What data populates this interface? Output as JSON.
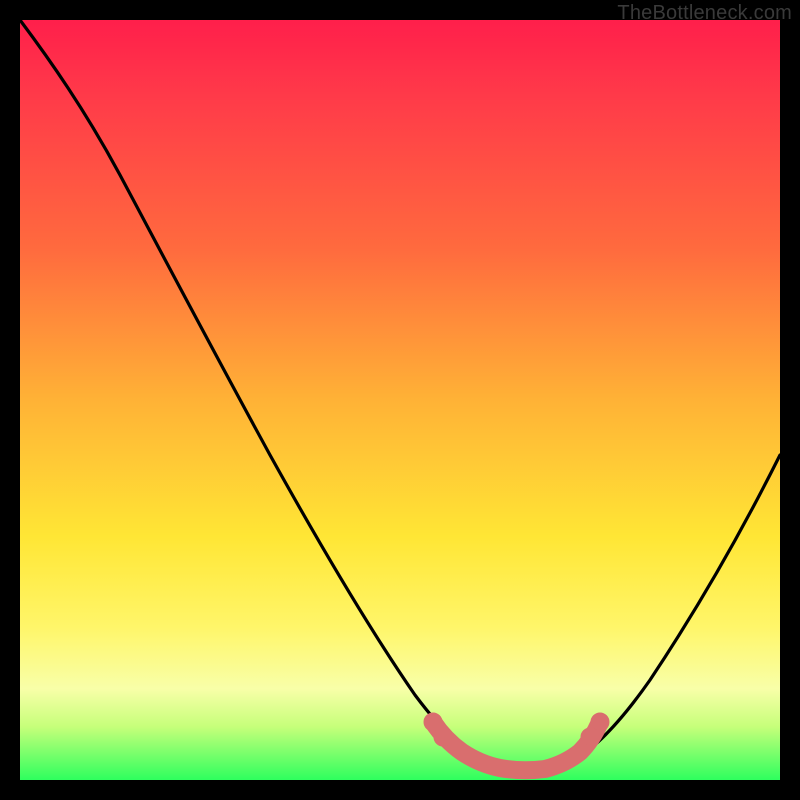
{
  "watermark": "TheBottleneck.com",
  "chart_data": {
    "type": "line",
    "title": "",
    "xlabel": "",
    "ylabel": "",
    "xlim": [
      0,
      100
    ],
    "ylim": [
      0,
      100
    ],
    "grid": false,
    "series": [
      {
        "name": "bottleneck-curve",
        "x": [
          0,
          6,
          12,
          18,
          24,
          30,
          36,
          42,
          48,
          52,
          56,
          60,
          64,
          68,
          72,
          76,
          80,
          84,
          88,
          92,
          96,
          100
        ],
        "y": [
          100,
          94,
          84,
          73,
          62,
          51,
          40,
          29,
          18,
          11,
          5,
          2,
          0,
          0,
          1,
          3,
          8,
          15,
          23,
          32,
          41,
          50
        ]
      }
    ],
    "annotations": [
      {
        "name": "optimal-highlight",
        "type": "segment",
        "color": "#d66a6a",
        "points_x": [
          54,
          55,
          58,
          60,
          63,
          66,
          69,
          71,
          73,
          75
        ],
        "points_y": [
          6.5,
          5.5,
          3.2,
          2.2,
          1.4,
          1.4,
          2.2,
          3.4,
          5.2,
          7.5
        ]
      }
    ],
    "background": {
      "type": "vertical-gradient",
      "stops": [
        {
          "pos": 0.0,
          "color": "#ff1f4b"
        },
        {
          "pos": 0.5,
          "color": "#ffb236"
        },
        {
          "pos": 0.8,
          "color": "#fff66a"
        },
        {
          "pos": 0.93,
          "color": "#c6ff7a"
        },
        {
          "pos": 1.0,
          "color": "#2eff5e"
        }
      ]
    }
  }
}
